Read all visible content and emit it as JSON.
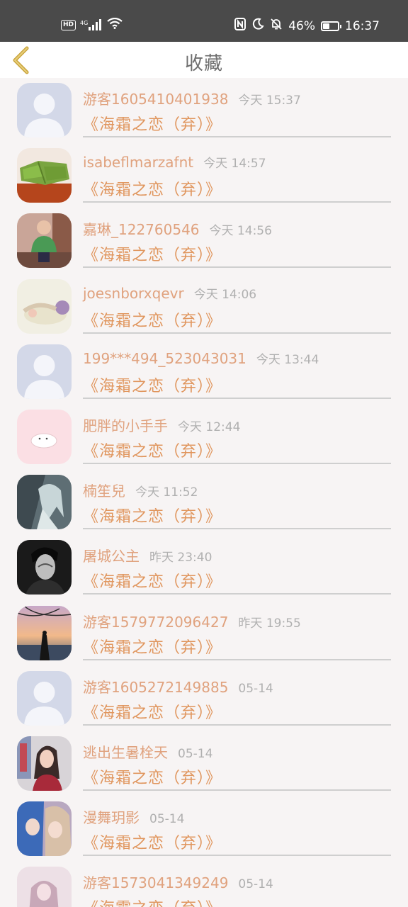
{
  "status_bar": {
    "left_icons": [
      "hd-icon",
      "4g-signal-icon",
      "wifi-icon"
    ],
    "right_icons": [
      "nfc-icon",
      "moon-icon",
      "bell-off-icon"
    ],
    "battery_percent": "46%",
    "battery_level": 0.46,
    "time": "16:37"
  },
  "header": {
    "title": "收藏",
    "back_icon": "chevron-left-icon"
  },
  "colors": {
    "accent": "#e0965e",
    "username": "#e0a27e",
    "timestamp": "#b0b0b0",
    "back_arrow": "#d6b04a"
  },
  "favorites": [
    {
      "username": "游客1605410401938",
      "time": "今天 15:37",
      "book": "《海霜之恋（弃）》",
      "avatar": "default"
    },
    {
      "username": "isabeflmarzafnt",
      "time": "今天 14:57",
      "book": "《海霜之恋（弃）》",
      "avatar": "food"
    },
    {
      "username": "嘉琳_122760546",
      "time": "今天 14:56",
      "book": "《海霜之恋（弃）》",
      "avatar": "child"
    },
    {
      "username": "joesnborxqevr",
      "time": "今天 14:06",
      "book": "《海霜之恋（弃）》",
      "avatar": "pale"
    },
    {
      "username": "199***494_523043031",
      "time": "今天 13:44",
      "book": "《海霜之恋（弃）》",
      "avatar": "default"
    },
    {
      "username": "肥胖的小手手",
      "time": "今天 12:44",
      "book": "《海霜之恋（弃）》",
      "avatar": "seal"
    },
    {
      "username": "楠笙兒",
      "time": "今天 11:52",
      "book": "《海霜之恋（弃）》",
      "avatar": "anime"
    },
    {
      "username": "屠城公主",
      "time": "昨天 23:40",
      "book": "《海霜之恋（弃）》",
      "avatar": "bw"
    },
    {
      "username": "游客1579772096427",
      "time": "昨天 19:55",
      "book": "《海霜之恋（弃）》",
      "avatar": "sunset"
    },
    {
      "username": "游客1605272149885",
      "time": "05-14",
      "book": "《海霜之恋（弃）》",
      "avatar": "default"
    },
    {
      "username": "逃出生暑栓天",
      "time": "05-14",
      "book": "《海霜之恋（弃）》",
      "avatar": "girl"
    },
    {
      "username": "漫舞玥影",
      "time": "05-14",
      "book": "《海霜之恋（弃）》",
      "avatar": "couple"
    },
    {
      "username": "游客1573041349249",
      "time": "05-14",
      "book": "《海霜之恋（弃）》",
      "avatar": "pink"
    }
  ]
}
